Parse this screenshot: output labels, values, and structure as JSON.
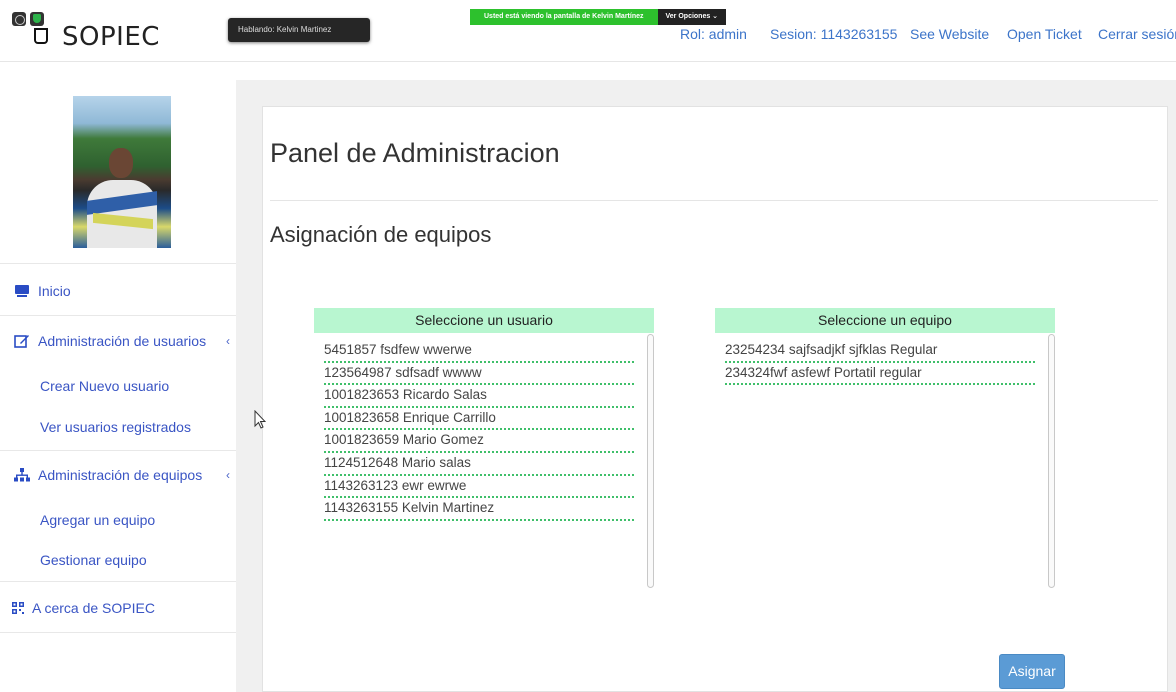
{
  "app": {
    "brand": "SOPIEC"
  },
  "zoom_overlay": {
    "speaking_label": "Hablando: Kelvin Martinez",
    "sharing_label": "Usted está viendo la pantalla de Kelvin Martínez",
    "options_label": "Ver Opciones ⌄"
  },
  "topnav": {
    "rol": "Rol: admin",
    "sesion": "Sesion: 1143263155",
    "see_website": "See Website",
    "open_ticket": "Open Ticket",
    "cerrar": "Cerrar sesión"
  },
  "sidebar": {
    "inicio": "Inicio",
    "admin_usuarios": "Administración de usuarios",
    "crear_usuario": "Crear Nuevo usuario",
    "ver_usuarios": "Ver usuarios registrados",
    "admin_equipos": "Administración de equipos",
    "agregar_equipo": "Agregar un equipo",
    "gestionar_equipo": "Gestionar equipo",
    "acerca": "A cerca de SOPIEC",
    "chevron": "‹"
  },
  "main": {
    "title": "Panel de Administracion",
    "subtitle": "Asignación de equipos",
    "users_header": "Seleccione un usuario",
    "equip_header": "Seleccione un equipo",
    "users": [
      "5451857 fsdfew wwerwe",
      "123564987 sdfsadf wwww",
      "1001823653 Ricardo Salas",
      "1001823658 Enrique Carrillo",
      "1001823659 Mario Gomez",
      "1124512648 Mario salas",
      "1143263123 ewr ewrwe",
      "1143263155 Kelvin Martinez"
    ],
    "equipos": [
      "23254234 sajfsadjkf sjfklas Regular",
      "234324fwf asfewf Portatil regular"
    ],
    "assign_label": "Asignar"
  },
  "colors": {
    "accent": "#3c74c9",
    "panel_header": "#b8f6d0",
    "button": "#5b9bd5"
  }
}
